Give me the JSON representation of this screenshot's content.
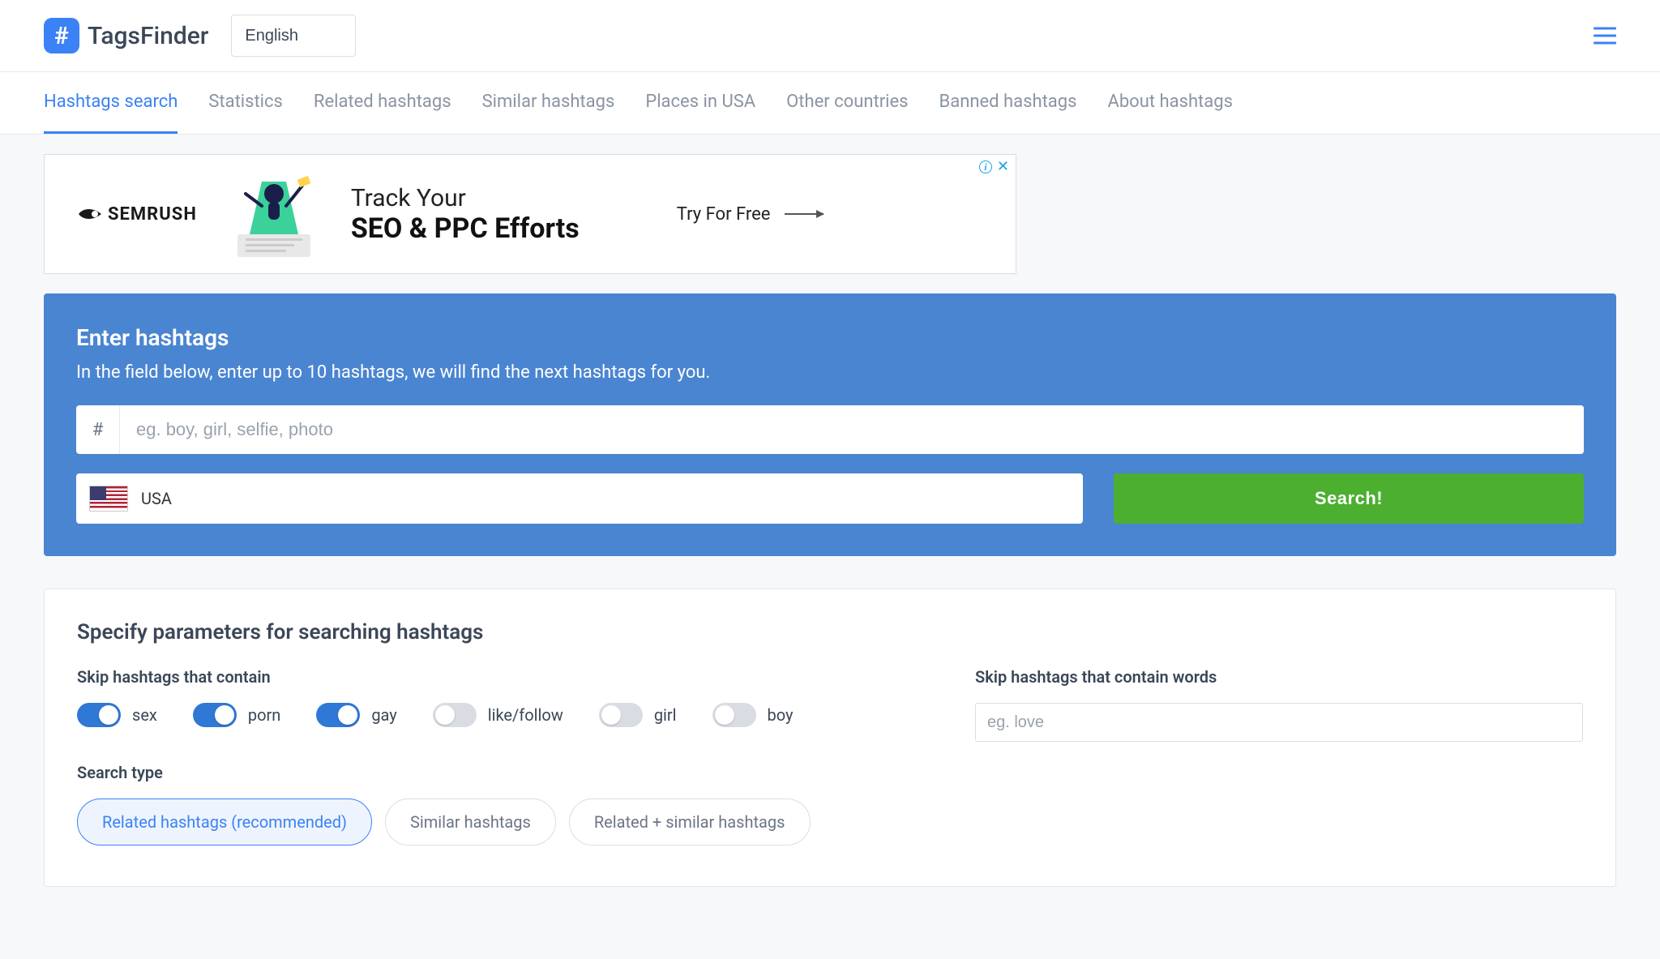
{
  "header": {
    "logo_text": "TagsFinder",
    "language": "English"
  },
  "nav": [
    {
      "label": "Hashtags search",
      "active": true
    },
    {
      "label": "Statistics",
      "active": false
    },
    {
      "label": "Related hashtags",
      "active": false
    },
    {
      "label": "Similar hashtags",
      "active": false
    },
    {
      "label": "Places in USA",
      "active": false
    },
    {
      "label": "Other countries",
      "active": false
    },
    {
      "label": "Banned hashtags",
      "active": false
    },
    {
      "label": "About hashtags",
      "active": false
    }
  ],
  "ad": {
    "brand": "SEMRUSH",
    "line1": "Track Your",
    "line2": "SEO & PPC Efforts",
    "cta": "Try For Free"
  },
  "search_panel": {
    "title": "Enter hashtags",
    "subtitle": "In the field below, enter up to 10 hashtags, we will find the next hashtags for you.",
    "hash_prefix": "#",
    "placeholder": "eg. boy, girl, selfie, photo",
    "country": "USA",
    "button": "Search!"
  },
  "params": {
    "title": "Specify parameters for searching hashtags",
    "skip_contain_heading": "Skip hashtags that contain",
    "toggles": [
      {
        "label": "sex",
        "on": true
      },
      {
        "label": "porn",
        "on": true
      },
      {
        "label": "gay",
        "on": true
      },
      {
        "label": "like/follow",
        "on": false
      },
      {
        "label": "girl",
        "on": false
      },
      {
        "label": "boy",
        "on": false
      }
    ],
    "skip_words_heading": "Skip hashtags that contain words",
    "skip_words_placeholder": "eg. love",
    "search_type_heading": "Search type",
    "search_types": [
      {
        "label": "Related hashtags (recommended)",
        "active": true
      },
      {
        "label": "Similar hashtags",
        "active": false
      },
      {
        "label": "Related + similar hashtags",
        "active": false
      }
    ]
  }
}
